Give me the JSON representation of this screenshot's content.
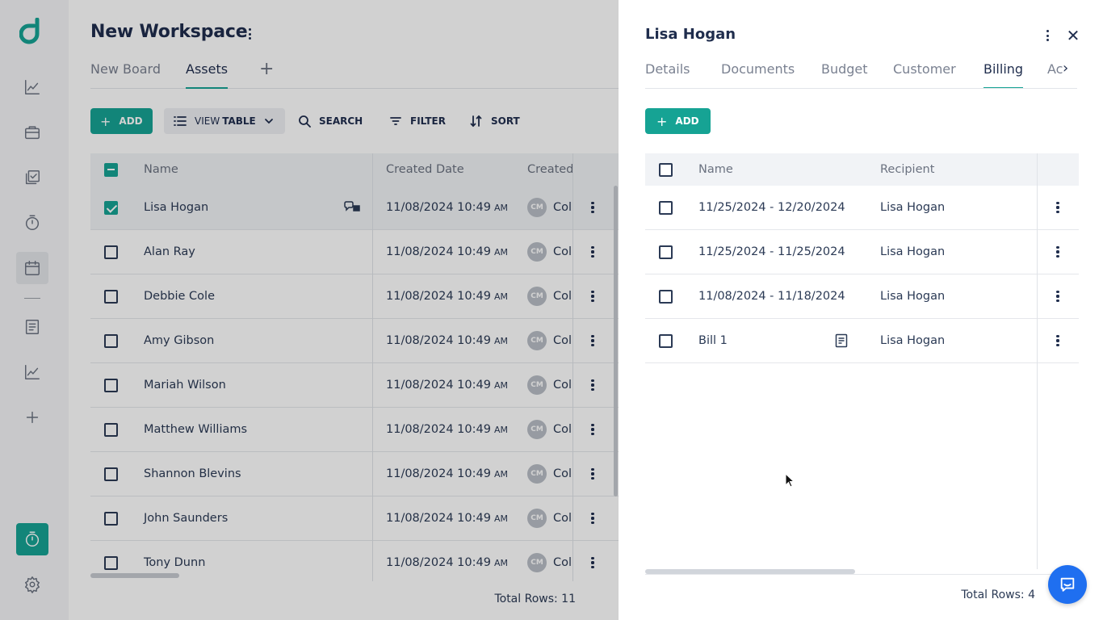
{
  "workspace": {
    "title": "New Workspace",
    "tabs": [
      "New Board",
      "Assets"
    ],
    "active_tab": "Assets",
    "add_tab_glyph": "+"
  },
  "toolbar": {
    "add_label": "ADD",
    "view_prefix": "VIEW",
    "view_value": "TABLE",
    "search_label": "SEARCH",
    "filter_label": "FILTER",
    "sort_label": "SORT"
  },
  "assets_table": {
    "columns": [
      "Name",
      "Created Date",
      "Created"
    ],
    "rows": [
      {
        "name": "Lisa Hogan",
        "date": "11/08/2024 10:49",
        "ampm": "AM",
        "initials": "CM",
        "creator": "Col",
        "selected": true
      },
      {
        "name": "Alan Ray",
        "date": "11/08/2024 10:49",
        "ampm": "AM",
        "initials": "CM",
        "creator": "Col",
        "selected": false
      },
      {
        "name": "Debbie Cole",
        "date": "11/08/2024 10:49",
        "ampm": "AM",
        "initials": "CM",
        "creator": "Col",
        "selected": false
      },
      {
        "name": "Amy Gibson",
        "date": "11/08/2024 10:49",
        "ampm": "AM",
        "initials": "CM",
        "creator": "Col",
        "selected": false
      },
      {
        "name": "Mariah Wilson",
        "date": "11/08/2024 10:49",
        "ampm": "AM",
        "initials": "CM",
        "creator": "Col",
        "selected": false
      },
      {
        "name": "Matthew Williams",
        "date": "11/08/2024 10:49",
        "ampm": "AM",
        "initials": "CM",
        "creator": "Col",
        "selected": false
      },
      {
        "name": "Shannon Blevins",
        "date": "11/08/2024 10:49",
        "ampm": "AM",
        "initials": "CM",
        "creator": "Col",
        "selected": false
      },
      {
        "name": "John Saunders",
        "date": "11/08/2024 10:49",
        "ampm": "AM",
        "initials": "CM",
        "creator": "Col",
        "selected": false
      },
      {
        "name": "Tony Dunn",
        "date": "11/08/2024 10:49",
        "ampm": "AM",
        "initials": "CM",
        "creator": "Col",
        "selected": false
      }
    ],
    "total_rows": "Total Rows: 11"
  },
  "panel": {
    "title": "Lisa Hogan",
    "close_glyph": "✕",
    "tab_arrow_glyph": "›",
    "tabs": [
      "Details",
      "Documents",
      "Budget",
      "Customer",
      "Billing",
      "Ac"
    ],
    "active_tab": "Billing",
    "add_label": "ADD",
    "columns": [
      "Name",
      "Recipient"
    ],
    "rows": [
      {
        "name": "11/25/2024 - 12/20/2024",
        "recipient": "Lisa Hogan",
        "has_doc_icon": false
      },
      {
        "name": "11/25/2024 - 11/25/2024",
        "recipient": "Lisa Hogan",
        "has_doc_icon": false
      },
      {
        "name": "11/08/2024 - 11/18/2024",
        "recipient": "Lisa Hogan",
        "has_doc_icon": false
      },
      {
        "name": "Bill 1",
        "recipient": "Lisa Hogan",
        "has_doc_icon": true
      }
    ],
    "total_rows": "Total Rows: 4"
  },
  "icons": {
    "rail": [
      "logo-icon",
      "analytics-icon",
      "briefcase-icon",
      "checklist-icon",
      "timer-icon",
      "calendar-icon",
      "document-icon",
      "chart-icon",
      "plus-icon",
      "timer-icon",
      "settings-icon"
    ]
  },
  "colors": {
    "accent": "#16a394",
    "text_primary": "#1f2d4d",
    "chat": "#1f6ff0"
  }
}
